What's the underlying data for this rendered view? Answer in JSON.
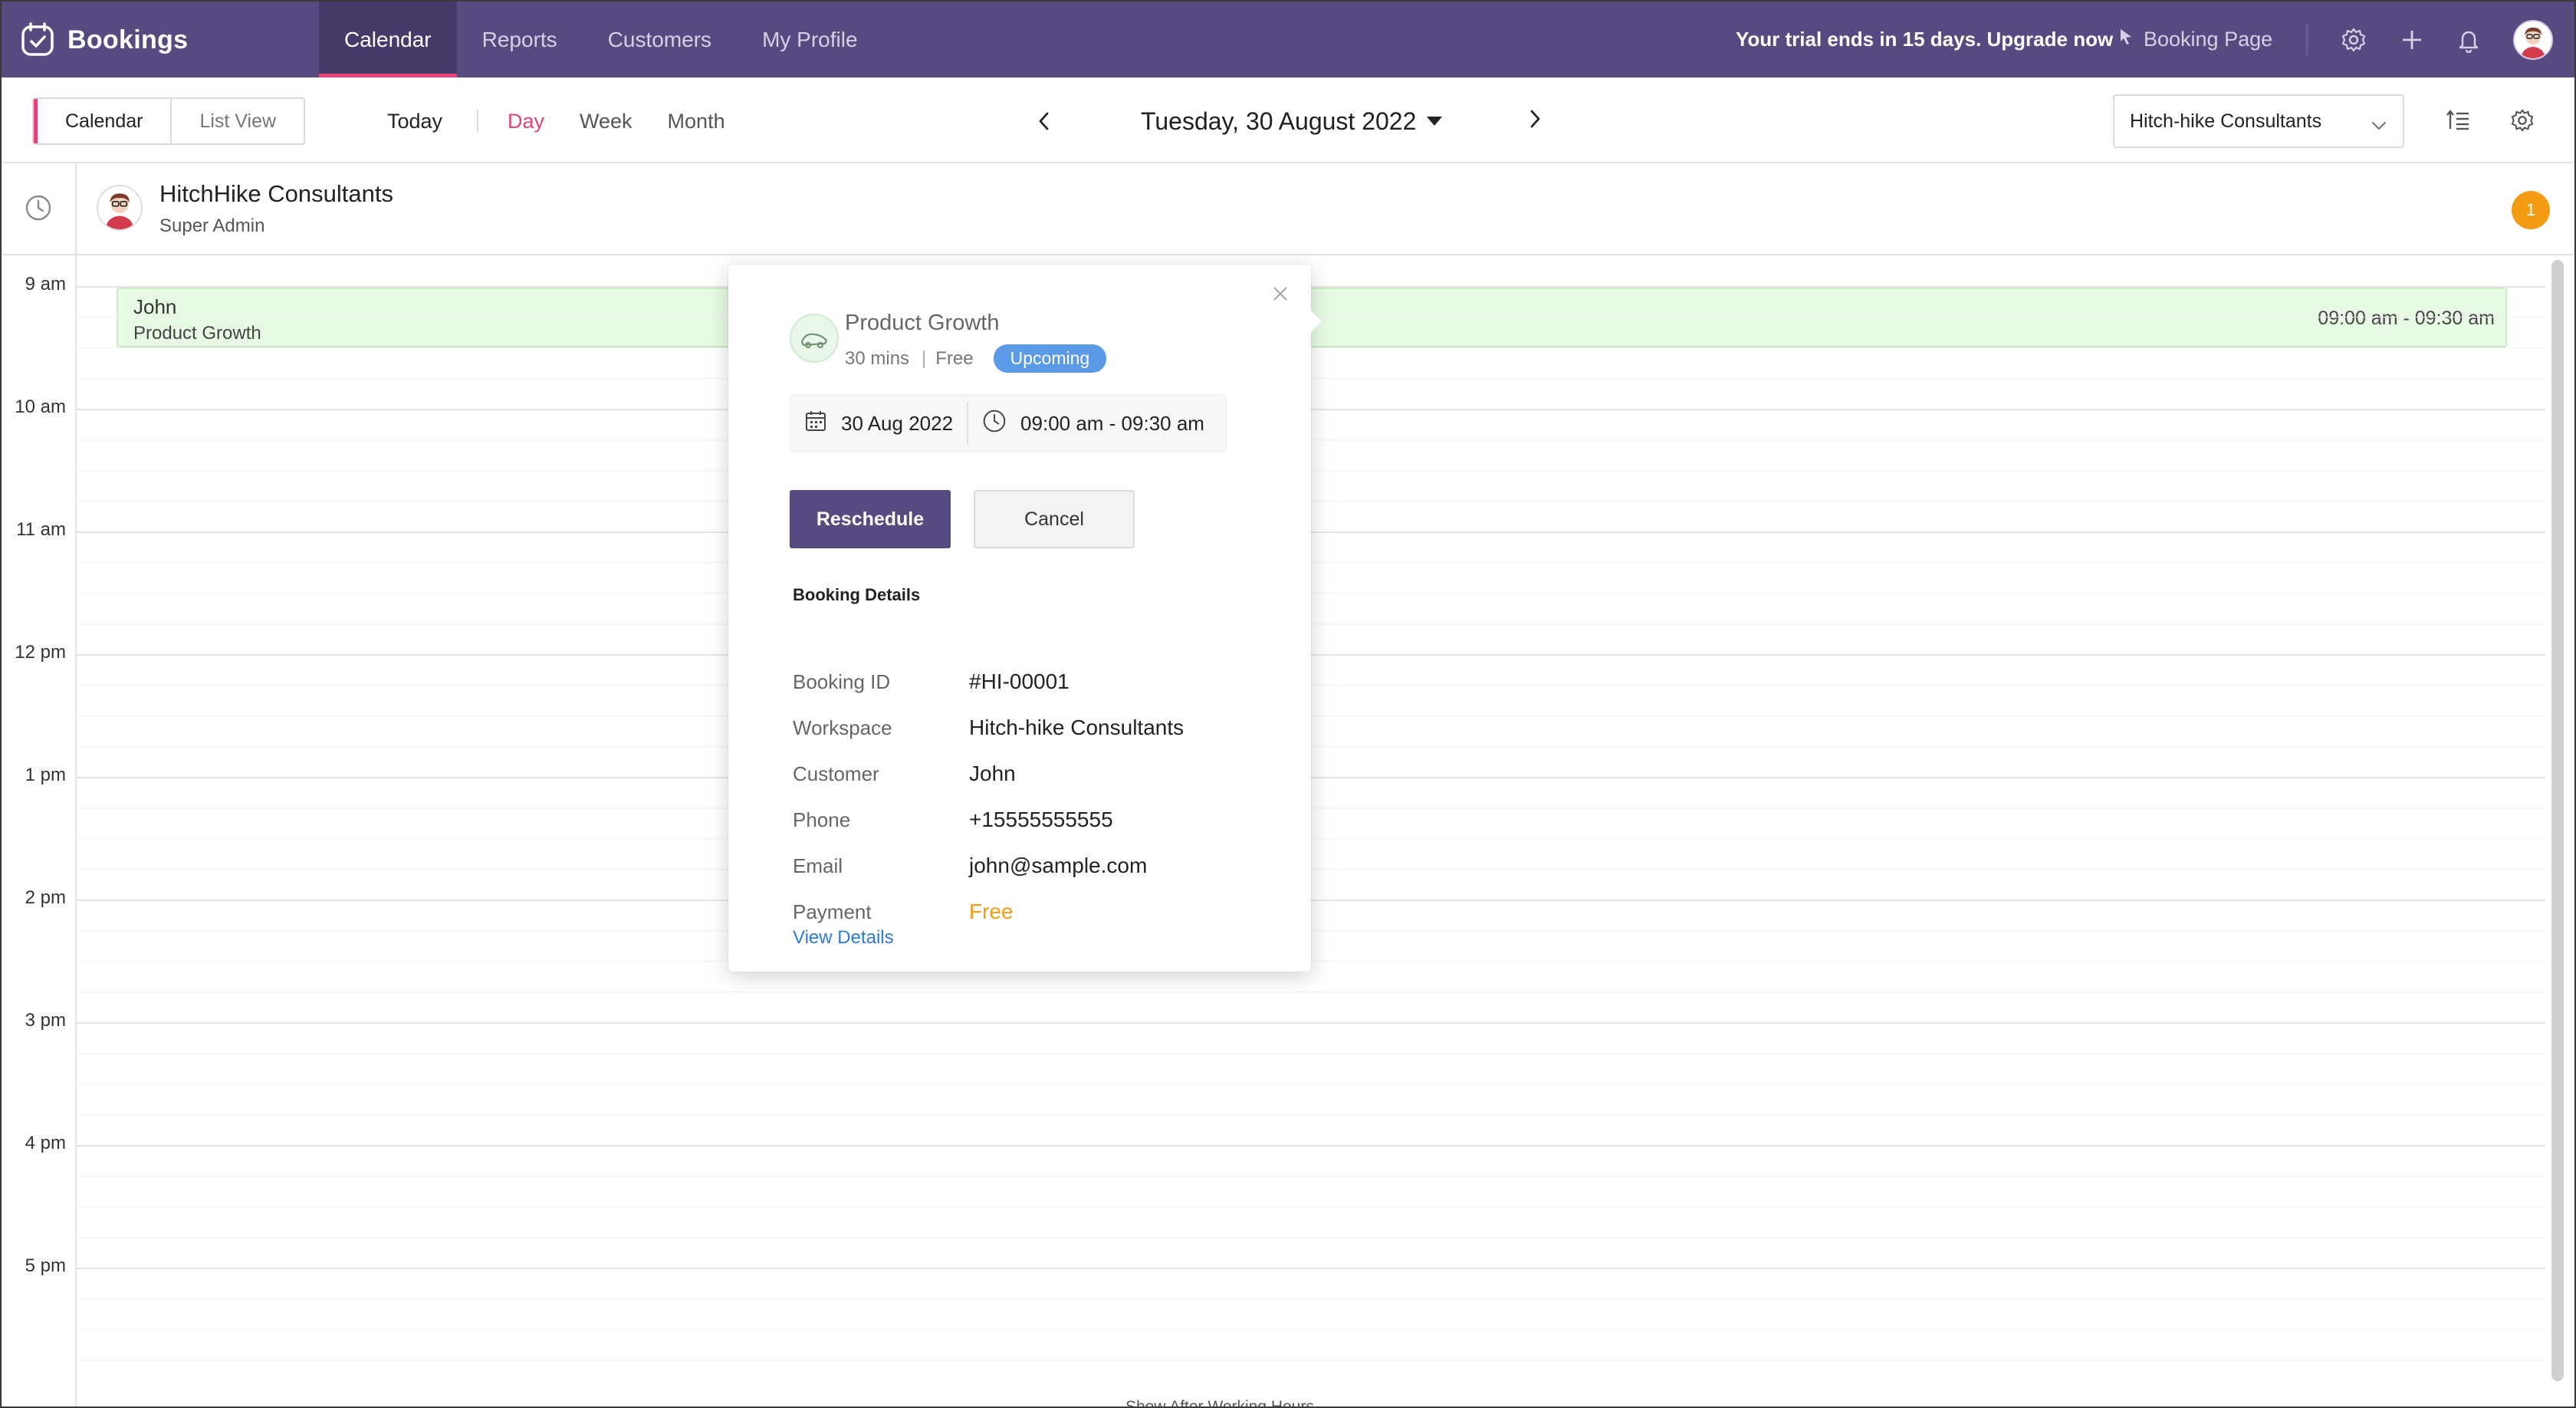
{
  "app": {
    "name": "Bookings",
    "nav": [
      "Calendar",
      "Reports",
      "Customers",
      "My Profile"
    ],
    "active_nav": "Calendar",
    "trial_text": "Your trial ends in 15 days. Upgrade now",
    "booking_page_label": "Booking Page"
  },
  "toolbar": {
    "view_modes": [
      "Calendar",
      "List View"
    ],
    "today_label": "Today",
    "ranges": [
      "Day",
      "Week",
      "Month"
    ],
    "date_title": "Tuesday, 30 August 2022",
    "workspace_selected": "Hitch-hike Consultants"
  },
  "staff": {
    "name": "HitchHike Consultants",
    "role": "Super Admin",
    "count": "1"
  },
  "grid": {
    "times": [
      "9 am",
      "10 am",
      "11 am",
      "12 pm",
      "1 pm",
      "2 pm",
      "3 pm",
      "4 pm",
      "5 pm"
    ],
    "working_hours_label": "ours",
    "show_after_label": "Show After Working Hours"
  },
  "event": {
    "customer": "John",
    "service": "Product Growth",
    "time": "09:00 am - 09:30 am"
  },
  "popover": {
    "service_name": "Product Growth",
    "duration": "30 mins",
    "price": "Free",
    "status": "Upcoming",
    "date": "30 Aug 2022",
    "time": "09:00 am - 09:30 am",
    "reschedule_label": "Reschedule",
    "cancel_label": "Cancel",
    "details_title": "Booking Details",
    "details": [
      {
        "key": "Booking ID",
        "value": "#HI-00001"
      },
      {
        "key": "Workspace",
        "value": "Hitch-hike Consultants"
      },
      {
        "key": "Customer",
        "value": "John"
      },
      {
        "key": "Phone",
        "value": "+15555555555"
      },
      {
        "key": "Email",
        "value": "john@sample.com"
      },
      {
        "key": "Payment",
        "value": "Free"
      }
    ],
    "view_details_label": "View Details"
  },
  "colors": {
    "topbar": "#574a80",
    "accent": "#e5427a",
    "status_pill": "#5b9ae6",
    "free": "#f39b13",
    "event_bg": "#e7fbe4"
  },
  "icons": [
    "bookings-logo-icon",
    "cursor-icon",
    "gear-icon",
    "plus-icon",
    "bell-icon",
    "chevron-left-icon",
    "chevron-right-icon",
    "chevron-down-icon",
    "sort-list-icon",
    "clock-icon",
    "calendar-icon",
    "close-icon",
    "service-icon"
  ]
}
